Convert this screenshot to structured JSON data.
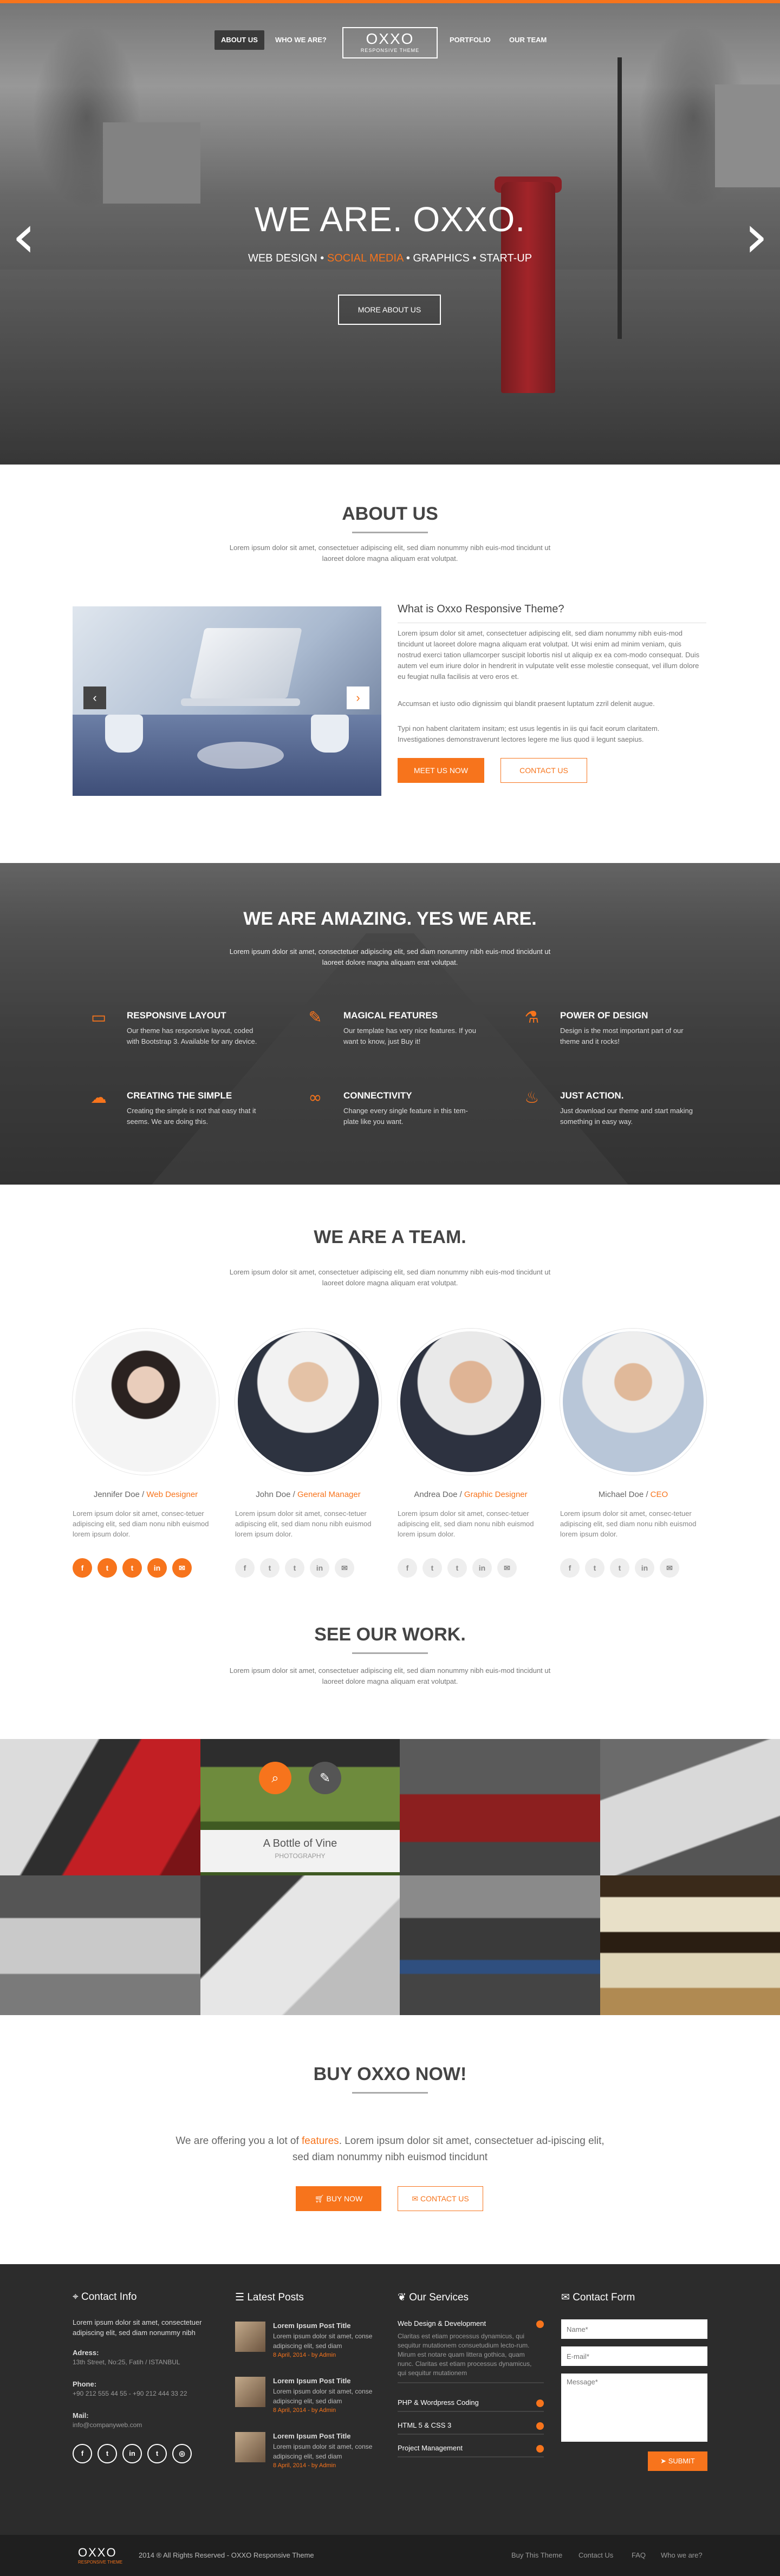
{
  "nav": {
    "items": [
      "ABOUT US",
      "WHO WE ARE?",
      "PORTFOLIO",
      "OUR TEAM"
    ],
    "logo": "OXXO",
    "logo_sub": "RESPONSIVE THEME"
  },
  "hero": {
    "title": "WE ARE. OXXO.",
    "sub_a": "WEB DESIGN • ",
    "sub_b": "SOCIAL MEDIA",
    "sub_c": " • GRAPHICS • START-UP",
    "button": "MORE ABOUT US",
    "prev_icon": "‹",
    "next_icon": "›"
  },
  "about": {
    "title": "ABOUT US",
    "text": "Lorem ipsum dolor sit amet, consectetuer adipiscing elit, sed diam nonummy nibh euis-mod tincidunt ut laoreet dolore magna aliquam erat volutpat.",
    "heading": "What is Oxxo Responsive Theme?",
    "p1": "Lorem ipsum dolor sit amet, consectetuer adipiscing elit, sed diam nonummy nibh euis-mod tincidunt ut laoreet dolore magna aliquam erat volutpat. Ut wisi enim ad minim veniam, quis nostrud exerci tation ullamcorper suscipit lobortis nisl ut aliquip ex ea com-modo consequat. Duis autem vel eum iriure dolor in hendrerit in vulputate velit esse molestie consequat, vel illum dolore eu feugiat nulla facilisis at vero eros et.",
    "p2": "Accumsan et iusto odio dignissim qui blandit praesent luptatum zzril delenit augue.",
    "p3": "Typi non habent claritatem insitam; est usus legentis in iis qui facit eorum claritatem. Investigationes demonstraverunt lectores legere me lius quod ii legunt saepius.",
    "btn_meet": "MEET US NOW",
    "btn_contact": "CONTACT US"
  },
  "amazing": {
    "title": "WE ARE AMAZING. YES WE ARE.",
    "text": "Lorem ipsum dolor sit amet, consectetuer adipiscing elit, sed diam nonummy nibh euis-mod tincidunt ut laoreet dolore magna aliquam erat volutpat.",
    "features": [
      {
        "icon": "monitor-icon",
        "glyph": "▭",
        "title": "RESPONSIVE LAYOUT",
        "text": "Our theme has responsive layout, coded with Bootstrap 3. Available for any device."
      },
      {
        "icon": "magic-wand-icon",
        "glyph": "✎",
        "title": "MAGICAL FEATURES",
        "text": "Our template has very nice features. If you want to know, just Buy it!"
      },
      {
        "icon": "flask-icon",
        "glyph": "⚗",
        "title": "POWER OF DESIGN",
        "text": "Design is the most important part of our theme and it rocks!"
      },
      {
        "icon": "cloud-icon",
        "glyph": "☁",
        "title": "CREATING THE SIMPLE",
        "text": "Creating the simple is not that easy that it seems. We are doing this."
      },
      {
        "icon": "link-icon",
        "glyph": "∞",
        "title": "CONNECTIVITY",
        "text": "Change every single feature in this tem-plate like you want."
      },
      {
        "icon": "fire-icon",
        "glyph": "♨",
        "title": "JUST ACTION.",
        "text": "Just download our theme and start making something in easy way."
      }
    ]
  },
  "team": {
    "title": "WE ARE A TEAM.",
    "text": "Lorem ipsum dolor sit amet, consectetuer adipiscing elit, sed diam nonummy nibh euis-mod tincidunt ut laoreet dolore magna aliquam erat volutpat.",
    "members": [
      {
        "name": "Jennifer Doe / ",
        "role": "Web Designer",
        "text": "Lorem ipsum dolor sit amet, consec-tetuer adipiscing elit, sed diam nonu nibh euismod lorem ipsum dolor."
      },
      {
        "name": "John Doe / ",
        "role": "General Manager",
        "text": "Lorem ipsum dolor sit amet, consec-tetuer adipiscing elit, sed diam nonu nibh euismod lorem ipsum dolor."
      },
      {
        "name": "Andrea Doe / ",
        "role": "Graphic Designer",
        "text": "Lorem ipsum dolor sit amet, consec-tetuer adipiscing elit, sed diam nonu nibh euismod lorem ipsum dolor."
      },
      {
        "name": "Michael Doe / ",
        "role": "CEO",
        "text": "Lorem ipsum dolor sit amet, consec-tetuer adipiscing elit, sed diam nonu nibh euismod lorem ipsum dolor."
      }
    ],
    "social": [
      "f",
      "t",
      "t",
      "in",
      "✉"
    ]
  },
  "work": {
    "title": "SEE OUR WORK.",
    "text": "Lorem ipsum dolor sit amet, consectetuer adipiscing elit, sed diam nonummy nibh euis-mod tincidunt ut laoreet dolore magna aliquam erat volutpat.",
    "caption_title": "A Bottle of Vine",
    "caption_sub": "PHOTOGRAPHY",
    "zoom_icon": "⌕",
    "link_icon": "✎"
  },
  "buy": {
    "title": "BUY OXXO NOW!",
    "text_a": "We are offering you a lot of ",
    "text_b": "features",
    "text_c": ". Lorem ipsum dolor sit amet, consectetuer ad-ipiscing elit, sed diam nonummy nibh euismod tincidunt",
    "btn_buy": "BUY NOW",
    "btn_contact": "CONTACT US"
  },
  "footer": {
    "contact": {
      "head": "Contact Info",
      "text": "Lorem ipsum dolor sit amet, consectetuer adipiscing elit, sed diam nonummy nibh",
      "address_label": "Adress:",
      "address": "13th Street, No:25, Fatih / ISTANBUL",
      "phone_label": "Phone:",
      "phone": "+90 212 555 44 55 - +90 212 444 33 22",
      "mail_label": "Mail:",
      "mail": "info@companyweb.com",
      "social": [
        "f",
        "t",
        "in",
        "t",
        "◎"
      ]
    },
    "posts": {
      "head": "Latest Posts",
      "items": [
        {
          "title": "Lorem Ipsum Post Title",
          "text": "Lorem ipsum dolor sit amet, conse adipiscing elit, sed diam",
          "date": "8 April, 2014 - by Admin"
        },
        {
          "title": "Lorem Ipsum Post Title",
          "text": "Lorem ipsum dolor sit amet, conse adipiscing elit, sed diam",
          "date": "8 April, 2014 - by Admin"
        },
        {
          "title": "Lorem Ipsum Post Title",
          "text": "Lorem ipsum dolor sit amet, conse adipiscing elit, sed diam",
          "date": "8 April, 2014 - by Admin"
        }
      ]
    },
    "services": {
      "head": "Our Services",
      "items": [
        {
          "title": "Web Design & Development",
          "text": "Claritas est etiam processus dynamicus, qui sequitur mutationem consuetudium lecto-rum. Mirum est notare quam littera gothica, quam nunc. Claritas est etiam processus dynamicus, qui sequitur mutationem"
        },
        {
          "title": "PHP & Wordpress Coding",
          "text": ""
        },
        {
          "title": "HTML 5 & CSS 3",
          "text": ""
        },
        {
          "title": "Project Management",
          "text": ""
        }
      ]
    },
    "form": {
      "head": "Contact Form",
      "name_ph": "Name*",
      "email_ph": "E-mail*",
      "message_ph": "Message*",
      "submit": "SUBMIT"
    },
    "bottom": {
      "logo": "OXXO",
      "logo_sub": "RESPONSIVE THEME",
      "copyright": "2014 ® All Rights Reserved - OXXO Responsive Theme",
      "links": [
        "Buy This Theme",
        "Contact Us",
        "FAQ",
        "Who we are?"
      ]
    }
  }
}
